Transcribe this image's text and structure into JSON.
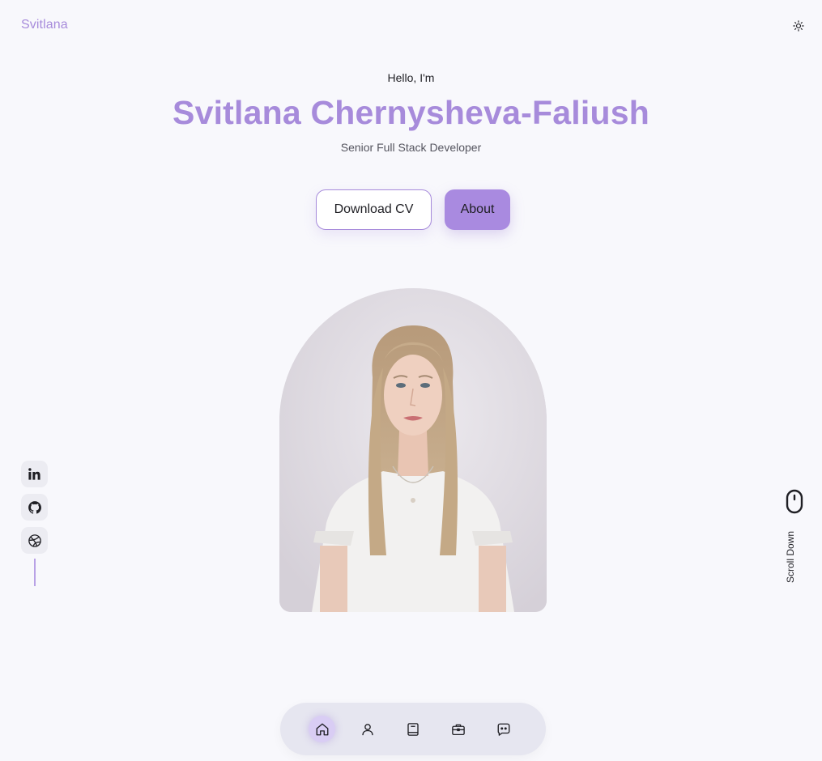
{
  "header": {
    "logo": "Svitlana",
    "theme_icon": "sun-icon"
  },
  "hero": {
    "greeting": "Hello, I'm",
    "name": "Svitlana Chernysheva-Faliush",
    "role": "Senior Full Stack Developer",
    "download_label": "Download CV",
    "about_label": "About"
  },
  "social": {
    "items": [
      {
        "name": "linkedin",
        "icon": "linkedin-icon"
      },
      {
        "name": "github",
        "icon": "github-icon"
      },
      {
        "name": "dribbble",
        "icon": "dribbble-icon"
      }
    ]
  },
  "scroll": {
    "label": "Scroll Down",
    "icon": "mouse-icon"
  },
  "bottom_nav": {
    "items": [
      {
        "name": "home",
        "icon": "home-icon",
        "active": true
      },
      {
        "name": "about",
        "icon": "user-icon",
        "active": false
      },
      {
        "name": "skills",
        "icon": "book-icon",
        "active": false
      },
      {
        "name": "services",
        "icon": "briefcase-icon",
        "active": false
      },
      {
        "name": "contact",
        "icon": "message-icon",
        "active": false
      }
    ]
  },
  "colors": {
    "accent": "#a78bdb",
    "background": "#f8f8fc",
    "text": "#1f1f24"
  }
}
